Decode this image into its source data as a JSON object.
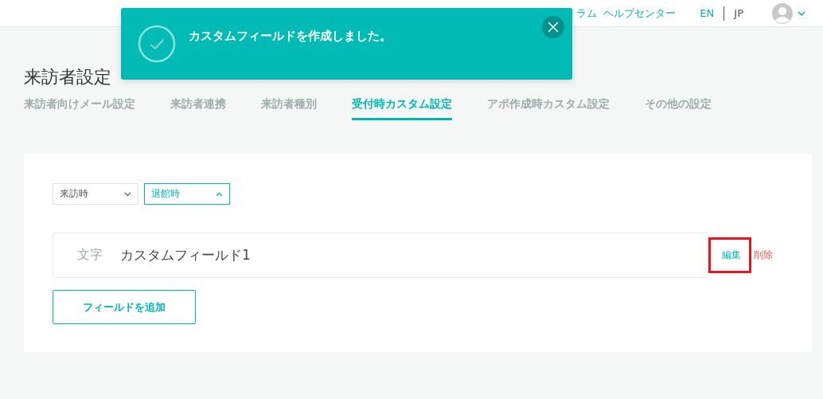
{
  "header": {
    "links": [
      {
        "label": "ラム"
      },
      {
        "label": "ヘルプセンター"
      }
    ],
    "languages": [
      {
        "label": "EN",
        "selected": true
      },
      {
        "label": "JP",
        "selected": false
      }
    ]
  },
  "toast": {
    "message": "カスタムフィールドを作成しました。"
  },
  "page_title": "来訪者設定",
  "tabs": [
    {
      "label": "来訪者向けメール設定",
      "selected": false
    },
    {
      "label": "来訪者連携",
      "selected": false
    },
    {
      "label": "来訪者種別",
      "selected": false
    },
    {
      "label": "受付時カスタム設定",
      "selected": true
    },
    {
      "label": "アポ作成時カスタム設定",
      "selected": false
    },
    {
      "label": "その他の設定",
      "selected": false
    }
  ],
  "timing_selects": [
    {
      "label": "来訪時",
      "selected": false
    },
    {
      "label": "退館時",
      "selected": true
    }
  ],
  "fields": [
    {
      "type": "文字",
      "name": "カスタムフィールド1",
      "actions": [
        {
          "label": "編集",
          "kind": "edit",
          "highlighted": true
        },
        {
          "label": "削除",
          "kind": "delete",
          "highlighted": false
        }
      ]
    }
  ],
  "add_button": "フィールドを追加"
}
